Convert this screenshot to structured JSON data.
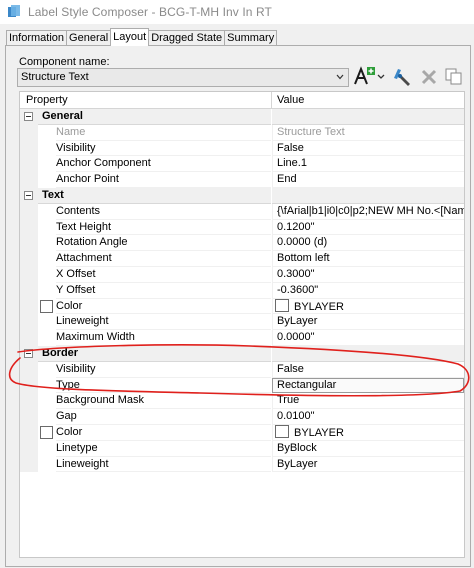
{
  "window": {
    "title": "Label Style Composer - BCG-T-MH Inv In RT"
  },
  "tabs": [
    {
      "label": "Information",
      "active": false
    },
    {
      "label": "General",
      "active": false
    },
    {
      "label": "Layout",
      "active": true
    },
    {
      "label": "Dragged State",
      "active": false
    },
    {
      "label": "Summary",
      "active": false
    }
  ],
  "component": {
    "label": "Component name:",
    "selected": "Structure Text"
  },
  "grid": {
    "headers": {
      "property": "Property",
      "value": "Value"
    },
    "rows": [
      {
        "kind": "category",
        "name": "General"
      },
      {
        "kind": "prop",
        "name": "Name",
        "value": "Structure Text",
        "disabled": true
      },
      {
        "kind": "prop",
        "name": "Visibility",
        "value": "False"
      },
      {
        "kind": "prop",
        "name": "Anchor Component",
        "value": "Line.1"
      },
      {
        "kind": "prop",
        "name": "Anchor Point",
        "value": "End"
      },
      {
        "kind": "category",
        "name": "Text"
      },
      {
        "kind": "prop",
        "name": "Contents",
        "value": "{\\fArial|b1|i0|c0|p2;NEW MH No.<[Nam..."
      },
      {
        "kind": "prop",
        "name": "Text Height",
        "value": "0.1200\""
      },
      {
        "kind": "prop",
        "name": "Rotation Angle",
        "value": "0.0000 (d)"
      },
      {
        "kind": "prop",
        "name": "Attachment",
        "value": "Bottom left"
      },
      {
        "kind": "prop",
        "name": "X Offset",
        "value": "0.3000\""
      },
      {
        "kind": "prop",
        "name": "Y Offset",
        "value": "-0.3600\""
      },
      {
        "kind": "color",
        "name": "Color",
        "value": "BYLAYER"
      },
      {
        "kind": "prop",
        "name": "Lineweight",
        "value": "ByLayer"
      },
      {
        "kind": "prop",
        "name": "Maximum Width",
        "value": "0.0000\""
      },
      {
        "kind": "category",
        "name": "Border"
      },
      {
        "kind": "prop",
        "name": "Visibility",
        "value": "False"
      },
      {
        "kind": "prop",
        "name": "Type",
        "value": "Rectangular",
        "selected": true
      },
      {
        "kind": "prop",
        "name": "Background Mask",
        "value": "True"
      },
      {
        "kind": "prop",
        "name": "Gap",
        "value": "0.0100\""
      },
      {
        "kind": "color",
        "name": "Color",
        "value": "BYLAYER"
      },
      {
        "kind": "prop",
        "name": "Linetype",
        "value": "ByBlock"
      },
      {
        "kind": "prop",
        "name": "Lineweight",
        "value": "ByLayer"
      }
    ]
  },
  "colors": {
    "annotation": "#e0201c",
    "selectedBorder": "#9a9a9a",
    "titleText": "#8a8a8a"
  },
  "icons": {
    "app": "civil3d-app-icon",
    "add": "add-text-component-icon",
    "edit": "edit-component-icon",
    "delete": "delete-component-icon",
    "copy": "copy-component-icon"
  }
}
